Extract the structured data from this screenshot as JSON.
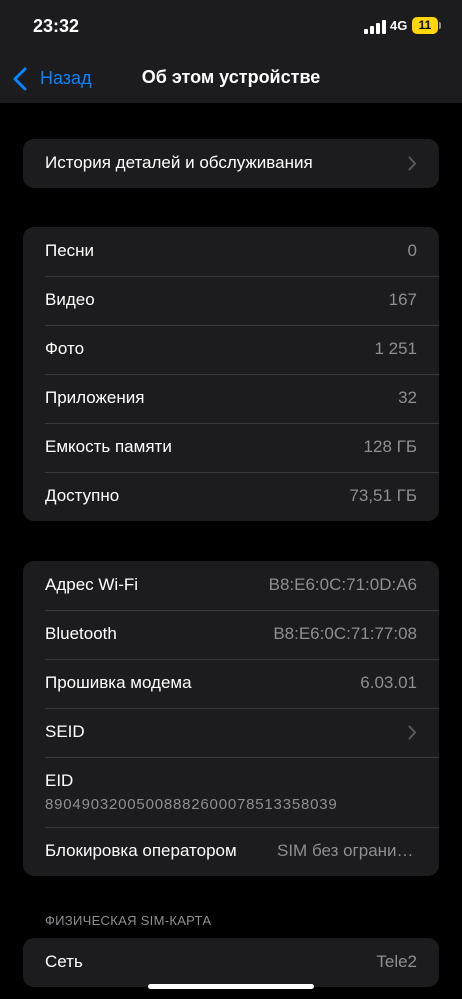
{
  "status_bar": {
    "time": "23:32",
    "network": "4G",
    "battery": "11",
    "battery_color": "#ffd60a"
  },
  "nav": {
    "back_label": "Назад",
    "title": "Об этом устройстве",
    "accent": "#0a84ff"
  },
  "service": {
    "label": "История деталей и обслуживания"
  },
  "stats": [
    {
      "label": "Песни",
      "value": "0"
    },
    {
      "label": "Видео",
      "value": "167"
    },
    {
      "label": "Фото",
      "value": "1 251"
    },
    {
      "label": "Приложения",
      "value": "32"
    },
    {
      "label": "Емкость памяти",
      "value": "128 ГБ"
    },
    {
      "label": "Доступно",
      "value": "73,51 ГБ"
    }
  ],
  "network": {
    "wifi": {
      "label": "Адрес Wi-Fi",
      "value": "B8:E6:0C:71:0D:A6"
    },
    "bluetooth": {
      "label": "Bluetooth",
      "value": "B8:E6:0C:71:77:08"
    },
    "modem": {
      "label": "Прошивка модема",
      "value": "6.03.01"
    },
    "seid": {
      "label": "SEID"
    },
    "eid": {
      "label": "EID",
      "value": "89049032005008882600078513358039"
    },
    "carrier_lock": {
      "label": "Блокировка оператором",
      "value": "SIM без ограничений"
    }
  },
  "sim": {
    "header": "ФИЗИЧЕСКАЯ SIM-КАРТА",
    "network": {
      "label": "Сеть",
      "value": "Tele2"
    }
  }
}
